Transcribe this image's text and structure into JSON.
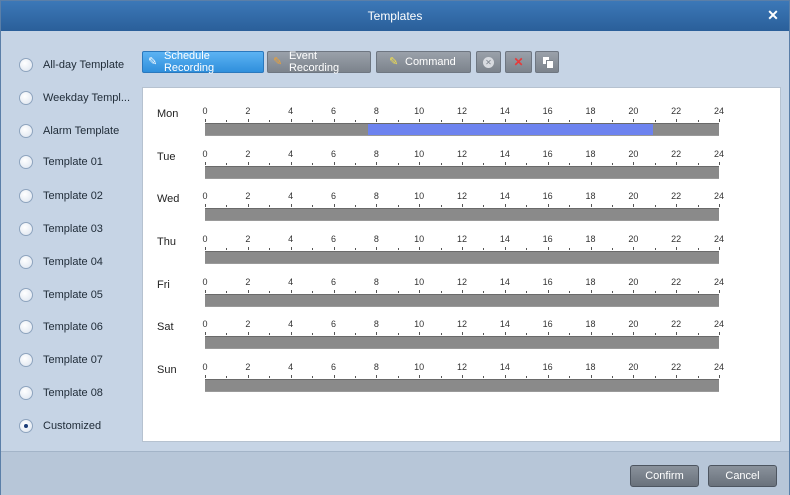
{
  "window": {
    "title": "Templates",
    "close_icon": "close-icon"
  },
  "templates": [
    {
      "label": "All-day Template",
      "checked": false
    },
    {
      "label": "Weekday Templ...",
      "checked": false
    },
    {
      "label": "Alarm Template",
      "checked": false
    },
    {
      "label": "Template 01",
      "checked": false
    },
    {
      "label": "Template 02",
      "checked": false
    },
    {
      "label": "Template 03",
      "checked": false
    },
    {
      "label": "Template 04",
      "checked": false
    },
    {
      "label": "Template 05",
      "checked": false
    },
    {
      "label": "Template 06",
      "checked": false
    },
    {
      "label": "Template 07",
      "checked": false
    },
    {
      "label": "Template 08",
      "checked": false
    },
    {
      "label": "Customized",
      "checked": true
    }
  ],
  "toolbar": {
    "schedule_label": "Schedule Recording",
    "event_label": "Event Recording",
    "command_label": "Command",
    "icons": [
      "pencil-icon",
      "clear-icon",
      "delete-icon",
      "copy-icon"
    ]
  },
  "hours": [
    "0",
    "2",
    "4",
    "6",
    "8",
    "10",
    "12",
    "14",
    "16",
    "18",
    "20",
    "22",
    "24"
  ],
  "schedule": [
    {
      "day": "Mon",
      "segments": [
        {
          "start": 7.6,
          "end": 20.9,
          "type": "schedule"
        }
      ]
    },
    {
      "day": "Tue",
      "segments": []
    },
    {
      "day": "Wed",
      "segments": []
    },
    {
      "day": "Thu",
      "segments": []
    },
    {
      "day": "Fri",
      "segments": []
    },
    {
      "day": "Sat",
      "segments": []
    },
    {
      "day": "Sun",
      "segments": []
    }
  ],
  "colors": {
    "schedule": "#6d83ef",
    "titlebar": "#2f6aa8",
    "active_tool": "#3c9ae6"
  },
  "footer": {
    "confirm_label": "Confirm",
    "cancel_label": "Cancel"
  }
}
